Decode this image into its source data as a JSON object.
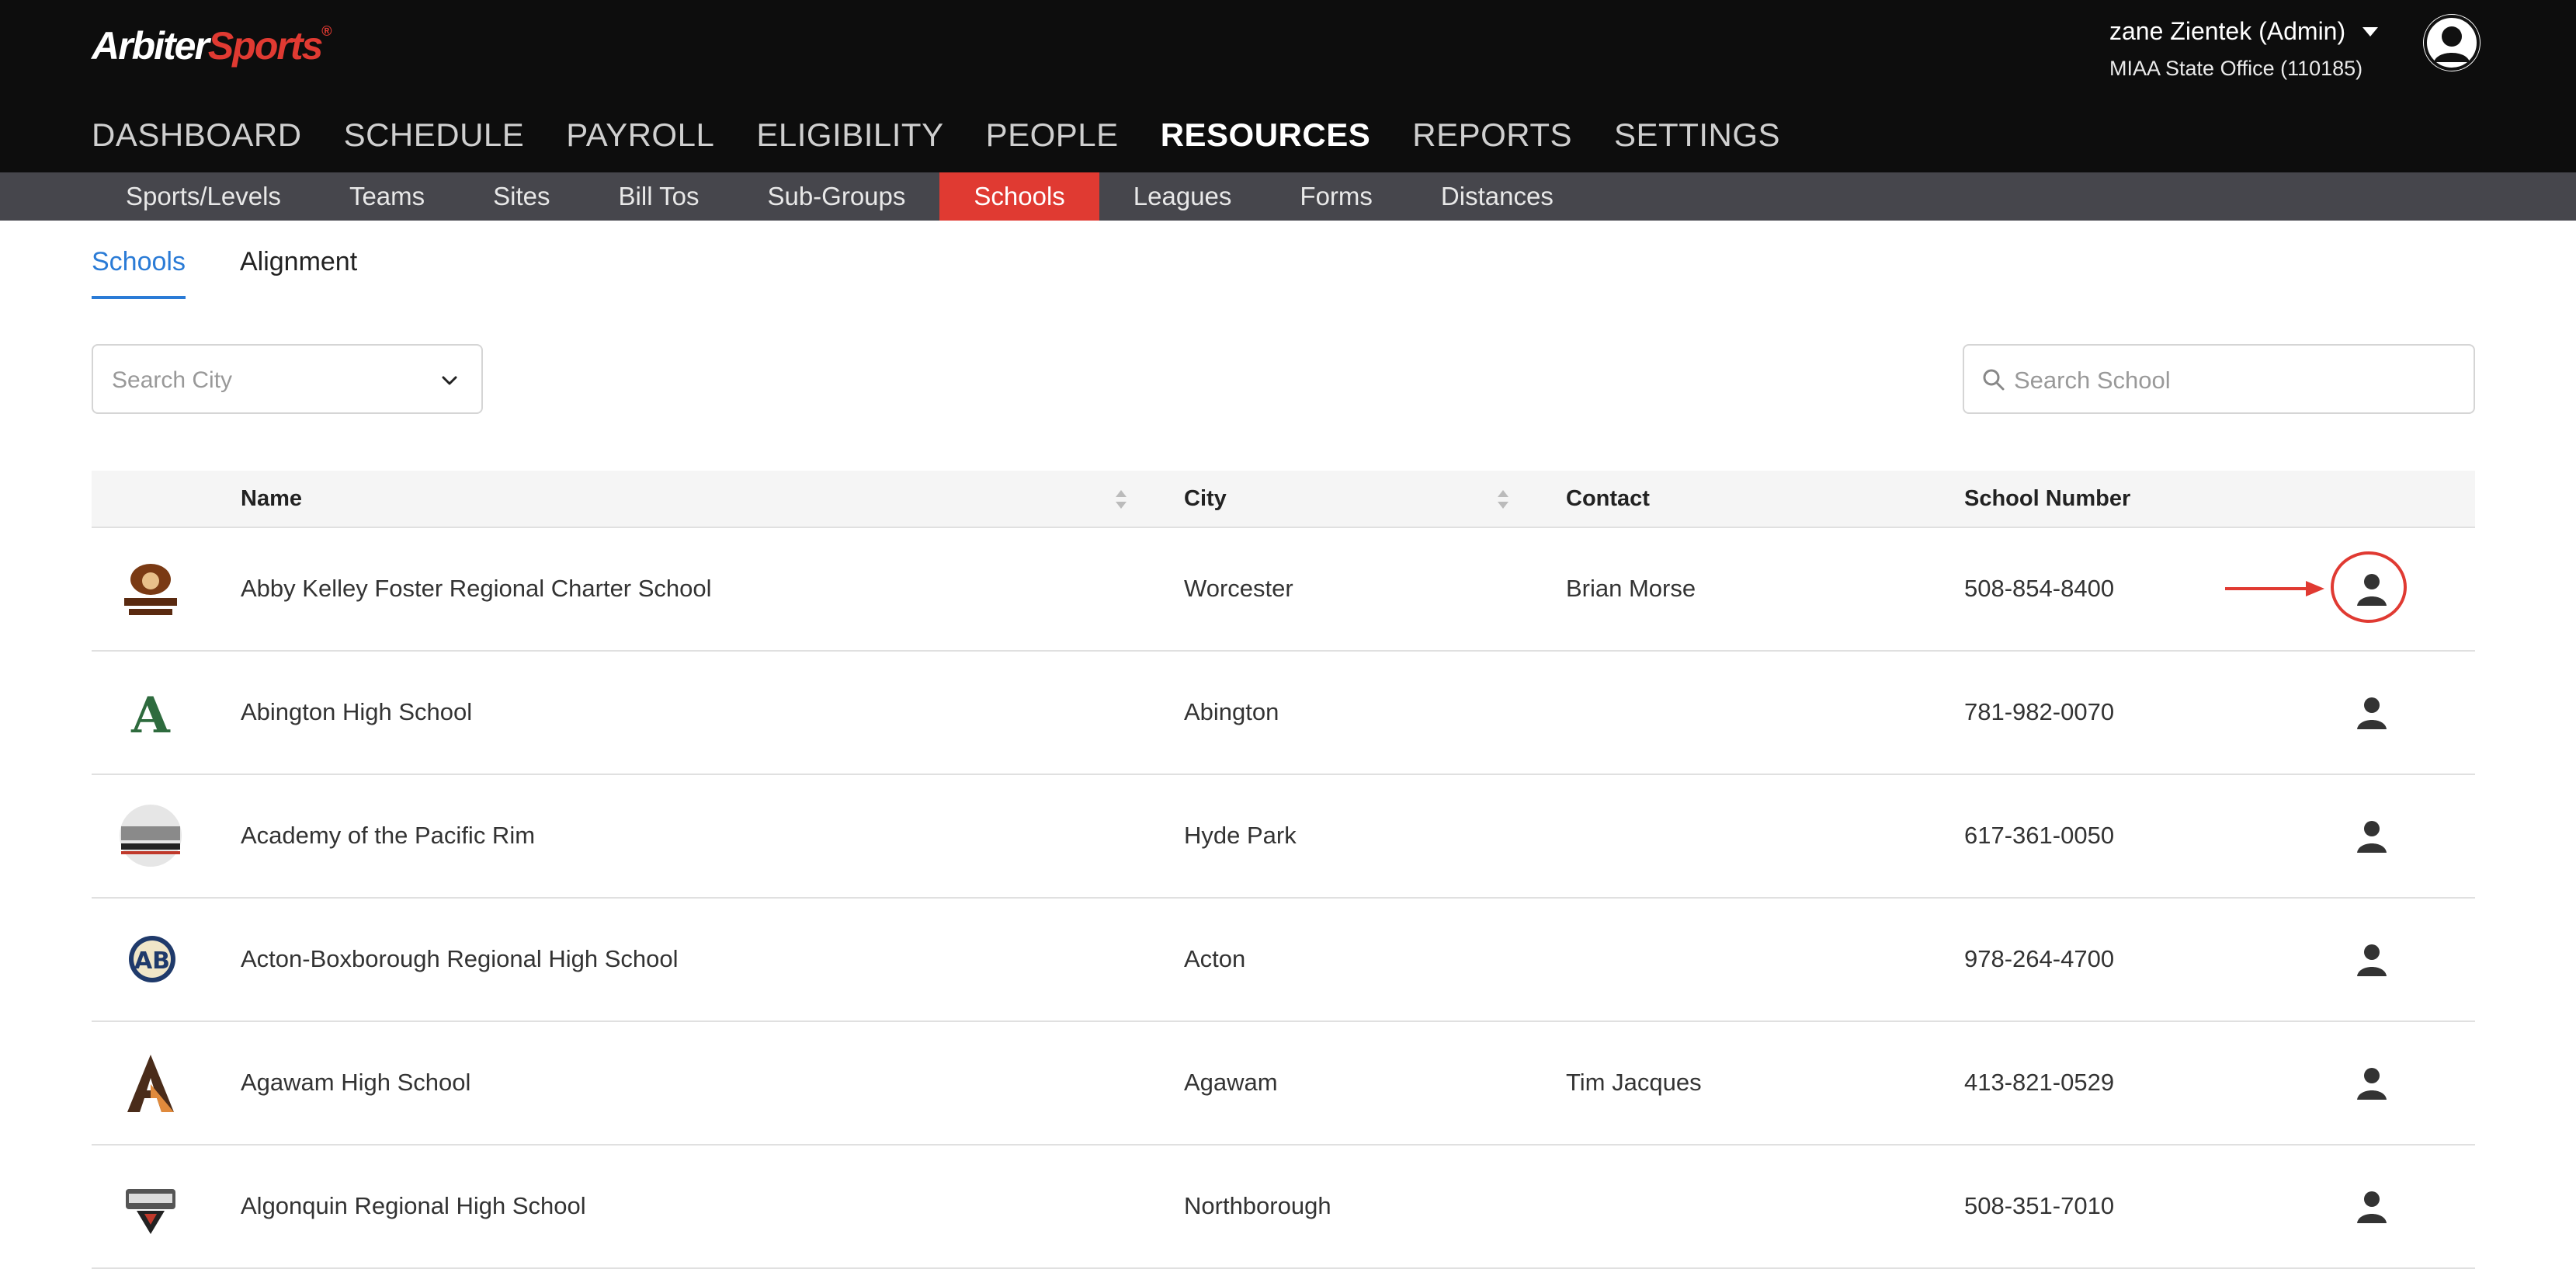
{
  "app": {
    "logo_main": "Arbiter",
    "logo_accent": "Sports",
    "logo_tm": "®"
  },
  "user": {
    "name": "zane Zientek (Admin)",
    "org": "MIAA State Office (110185)"
  },
  "main_nav": [
    {
      "label": "DASHBOARD"
    },
    {
      "label": "SCHEDULE"
    },
    {
      "label": "PAYROLL"
    },
    {
      "label": "ELIGIBILITY"
    },
    {
      "label": "PEOPLE"
    },
    {
      "label": "RESOURCES",
      "active": true
    },
    {
      "label": "REPORTS"
    },
    {
      "label": "SETTINGS"
    }
  ],
  "sub_nav": [
    {
      "label": "Sports/Levels"
    },
    {
      "label": "Teams"
    },
    {
      "label": "Sites"
    },
    {
      "label": "Bill Tos"
    },
    {
      "label": "Sub-Groups"
    },
    {
      "label": "Schools",
      "active": true
    },
    {
      "label": "Leagues"
    },
    {
      "label": "Forms"
    },
    {
      "label": "Distances"
    }
  ],
  "tabs": [
    {
      "label": "Schools",
      "active": true
    },
    {
      "label": "Alignment"
    }
  ],
  "filters": {
    "city_placeholder": "Search City",
    "school_placeholder": "Search School"
  },
  "table": {
    "headers": {
      "name": "Name",
      "city": "City",
      "contact": "Contact",
      "school_number": "School Number"
    },
    "rows": [
      {
        "name": "Abby Kelley Foster Regional Charter School",
        "city": "Worcester",
        "contact": "Brian Morse",
        "number": "508-854-8400",
        "logo_icon": "eagle-logo",
        "highlighted": true
      },
      {
        "name": "Abington High School",
        "city": "Abington",
        "contact": "",
        "number": "781-982-0070",
        "logo_icon": "green-a-logo"
      },
      {
        "name": "Academy of the Pacific Rim",
        "city": "Hyde Park",
        "contact": "",
        "number": "617-361-0050",
        "logo_icon": "pacific-rim-logo"
      },
      {
        "name": "Acton-Boxborough Regional High School",
        "city": "Acton",
        "contact": "",
        "number": "978-264-4700",
        "logo_icon": "ab-logo"
      },
      {
        "name": "Agawam High School",
        "city": "Agawam",
        "contact": "Tim Jacques",
        "number": "413-821-0529",
        "logo_icon": "orange-a-logo"
      },
      {
        "name": "Algonquin Regional High School",
        "city": "Northborough",
        "contact": "",
        "number": "508-351-7010",
        "logo_icon": "algonquin-logo"
      }
    ]
  },
  "colors": {
    "topbar": "#0d0d0d",
    "subnav": "#46464c",
    "accent_red": "#e03a32",
    "tab_blue": "#2a7bd6"
  }
}
